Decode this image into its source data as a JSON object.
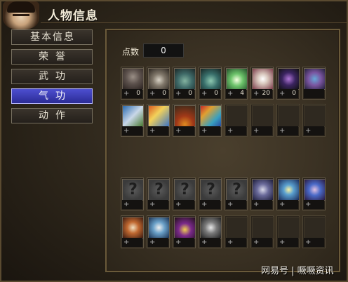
{
  "window": {
    "title": "人物信息"
  },
  "tabs": [
    {
      "label": "基本信息",
      "active": false
    },
    {
      "label": "荣誉",
      "active": false
    },
    {
      "label": "武功",
      "active": false
    },
    {
      "label": "气功",
      "active": true
    },
    {
      "label": "动作",
      "active": false
    }
  ],
  "points": {
    "label": "点数",
    "value": "0"
  },
  "row1": [
    {
      "name": "qigong-skill-1-icon",
      "plus": "+",
      "level": "0"
    },
    {
      "name": "qigong-skill-2-icon",
      "plus": "+",
      "level": "0"
    },
    {
      "name": "qigong-skill-3-icon",
      "plus": "+",
      "level": "0"
    },
    {
      "name": "qigong-skill-4-icon",
      "plus": "+",
      "level": "0"
    },
    {
      "name": "qigong-skill-5-icon",
      "plus": "+",
      "level": "4"
    },
    {
      "name": "qigong-skill-6-icon",
      "plus": "+",
      "level": "20"
    },
    {
      "name": "qigong-skill-7-icon",
      "plus": "+",
      "level": "0"
    },
    {
      "name": "qigong-skill-8-icon",
      "plus": "",
      "level": ""
    }
  ],
  "row2": [
    {
      "plus": "+",
      "level": ""
    },
    {
      "plus": "+",
      "level": ""
    },
    {
      "plus": "+",
      "level": ""
    },
    {
      "plus": "+",
      "level": ""
    },
    {
      "plus": "+",
      "level": ""
    },
    {
      "plus": "+",
      "level": ""
    },
    {
      "plus": "+",
      "level": ""
    },
    {
      "plus": "+",
      "level": ""
    }
  ],
  "row3": [
    {
      "q": "?",
      "plus": "+"
    },
    {
      "q": "?",
      "plus": "+"
    },
    {
      "q": "?",
      "plus": "+"
    },
    {
      "q": "?",
      "plus": "+"
    },
    {
      "q": "?",
      "plus": "+"
    },
    {
      "q": "",
      "plus": "+"
    },
    {
      "q": "",
      "plus": "+"
    },
    {
      "q": "",
      "plus": "+"
    }
  ],
  "row4": [
    {
      "plus": "+"
    },
    {
      "plus": "+"
    },
    {
      "plus": "+"
    },
    {
      "plus": "+"
    },
    {
      "plus": "+"
    },
    {
      "plus": "+"
    },
    {
      "plus": "+"
    },
    {
      "plus": "+"
    }
  ],
  "watermark": "网易号 | 噘噘资讯"
}
